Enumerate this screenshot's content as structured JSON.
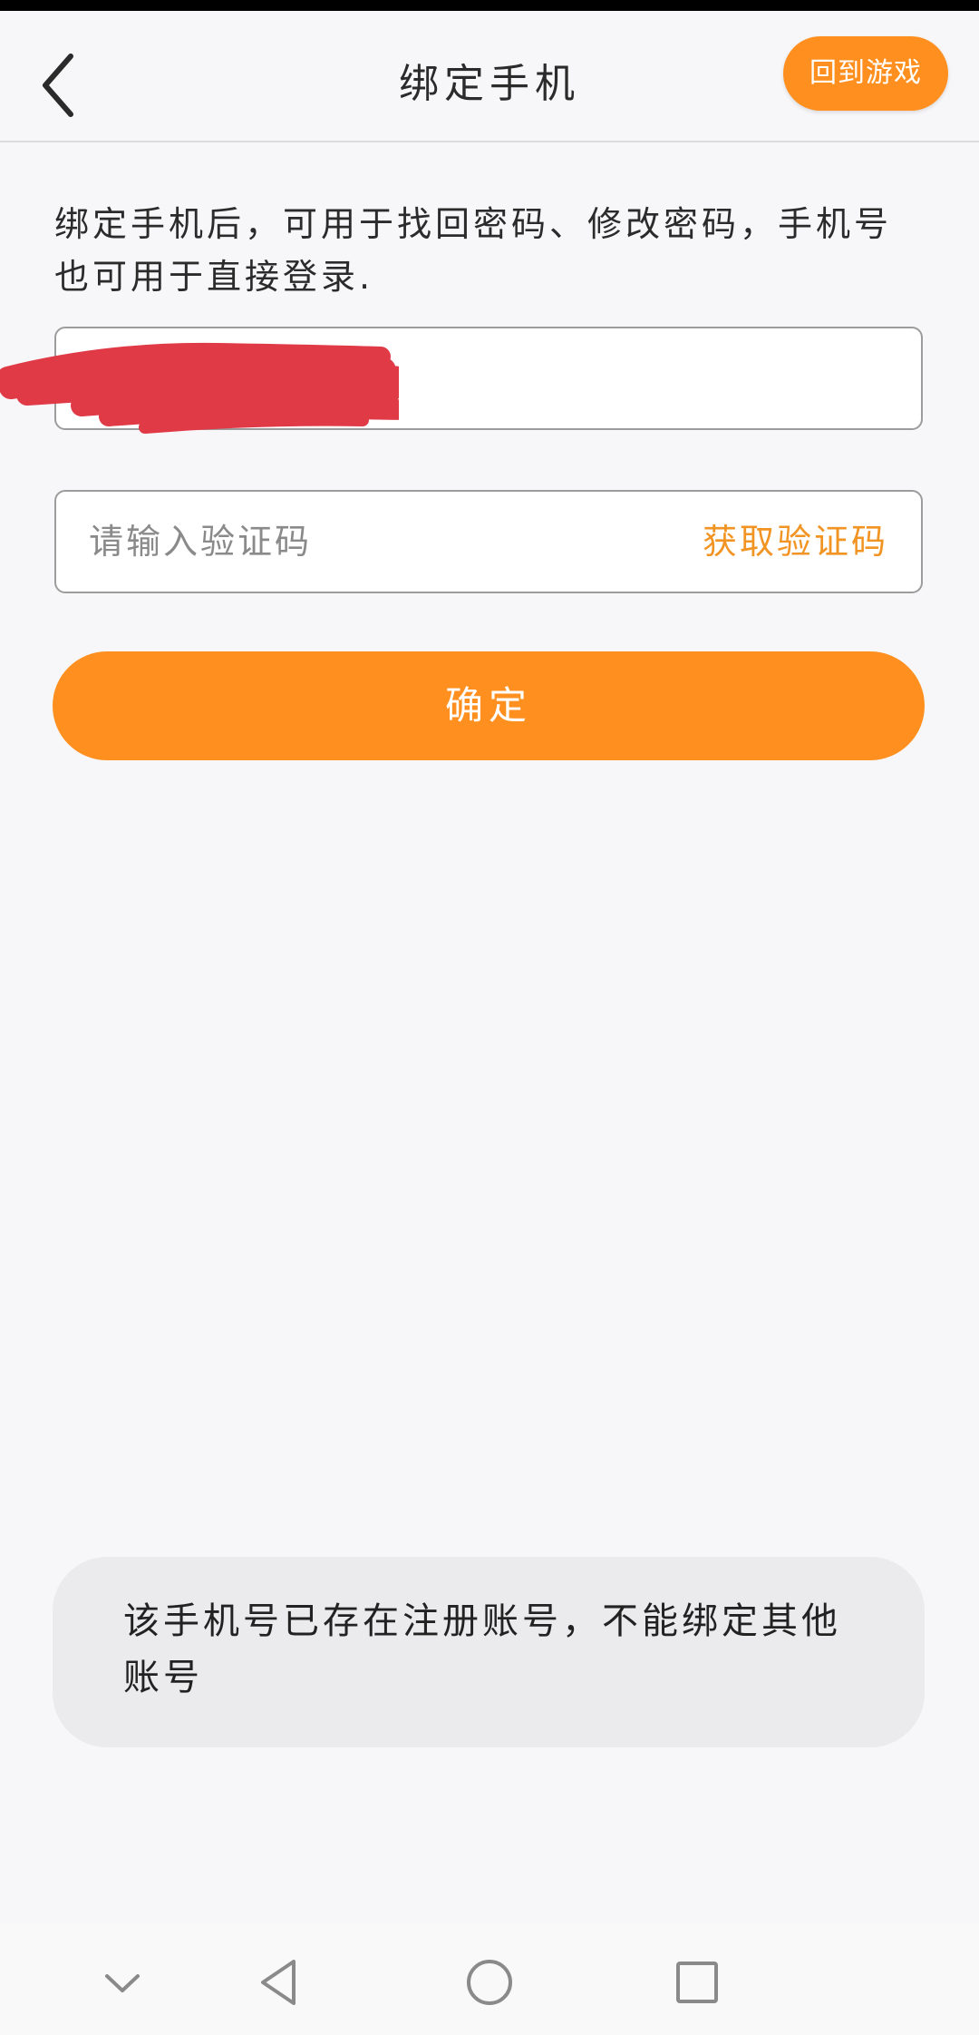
{
  "header": {
    "title": "绑定手机",
    "return_game_label": "回到游戏"
  },
  "description": "绑定手机后，可用于找回密码、修改密码，手机号也可用于直接登录.",
  "phone_input": {
    "value": ""
  },
  "code_input": {
    "placeholder": "请输入验证码",
    "get_code_label": "获取验证码"
  },
  "confirm_label": "确定",
  "toast_message": "该手机号已存在注册账号，不能绑定其他账号",
  "colors": {
    "accent": "#ff8f1f",
    "link": "#f29423",
    "background": "#f7f7f9",
    "redaction": "#e03a47"
  },
  "icons": {
    "back": "chevron-left-icon",
    "nav_collapse": "chevron-down-icon",
    "nav_back": "triangle-back-icon",
    "nav_home": "circle-home-icon",
    "nav_recent": "square-recent-icon"
  }
}
